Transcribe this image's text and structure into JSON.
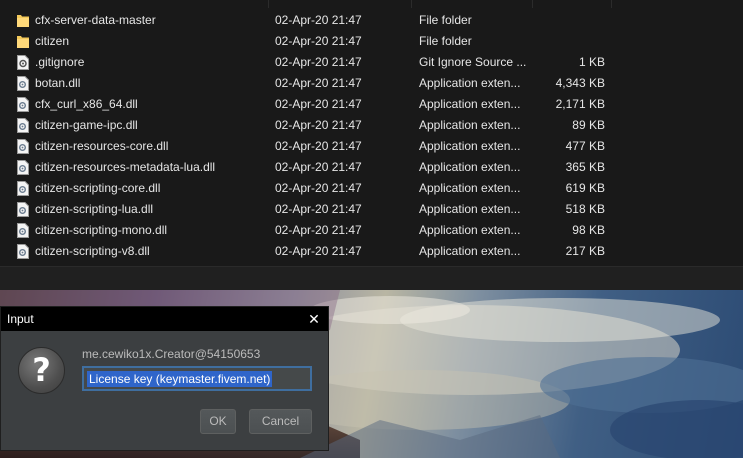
{
  "explorer": {
    "files": [
      {
        "name": "cfx-server-data-master",
        "date": "02-Apr-20 21:47",
        "type": "File folder",
        "size": "",
        "icon": "folder-icon"
      },
      {
        "name": "citizen",
        "date": "02-Apr-20 21:47",
        "type": "File folder",
        "size": "",
        "icon": "folder-icon"
      },
      {
        "name": ".gitignore",
        "date": "02-Apr-20 21:47",
        "type": "Git Ignore Source ...",
        "size": "1 KB",
        "icon": "gear-file-icon"
      },
      {
        "name": "botan.dll",
        "date": "02-Apr-20 21:47",
        "type": "Application exten...",
        "size": "4,343 KB",
        "icon": "dll-file-icon"
      },
      {
        "name": "cfx_curl_x86_64.dll",
        "date": "02-Apr-20 21:47",
        "type": "Application exten...",
        "size": "2,171 KB",
        "icon": "dll-file-icon"
      },
      {
        "name": "citizen-game-ipc.dll",
        "date": "02-Apr-20 21:47",
        "type": "Application exten...",
        "size": "89 KB",
        "icon": "dll-file-icon"
      },
      {
        "name": "citizen-resources-core.dll",
        "date": "02-Apr-20 21:47",
        "type": "Application exten...",
        "size": "477 KB",
        "icon": "dll-file-icon"
      },
      {
        "name": "citizen-resources-metadata-lua.dll",
        "date": "02-Apr-20 21:47",
        "type": "Application exten...",
        "size": "365 KB",
        "icon": "dll-file-icon"
      },
      {
        "name": "citizen-scripting-core.dll",
        "date": "02-Apr-20 21:47",
        "type": "Application exten...",
        "size": "619 KB",
        "icon": "dll-file-icon"
      },
      {
        "name": "citizen-scripting-lua.dll",
        "date": "02-Apr-20 21:47",
        "type": "Application exten...",
        "size": "518 KB",
        "icon": "dll-file-icon"
      },
      {
        "name": "citizen-scripting-mono.dll",
        "date": "02-Apr-20 21:47",
        "type": "Application exten...",
        "size": "98 KB",
        "icon": "dll-file-icon"
      },
      {
        "name": "citizen-scripting-v8.dll",
        "date": "02-Apr-20 21:47",
        "type": "Application exten...",
        "size": "217 KB",
        "icon": "dll-file-icon"
      }
    ]
  },
  "dialog": {
    "title": "Input",
    "close_glyph": "✕",
    "question_glyph": "?",
    "message": "me.cewiko1x.Creator@54150653",
    "input_value": "License key (keymaster.fivem.net)",
    "ok_label": "OK",
    "cancel_label": "Cancel"
  },
  "colors": {
    "explorer_bg": "#191919",
    "dialog_bg": "#3c3f41",
    "selection": "#2f65ca",
    "folder": "#f3c95a"
  }
}
